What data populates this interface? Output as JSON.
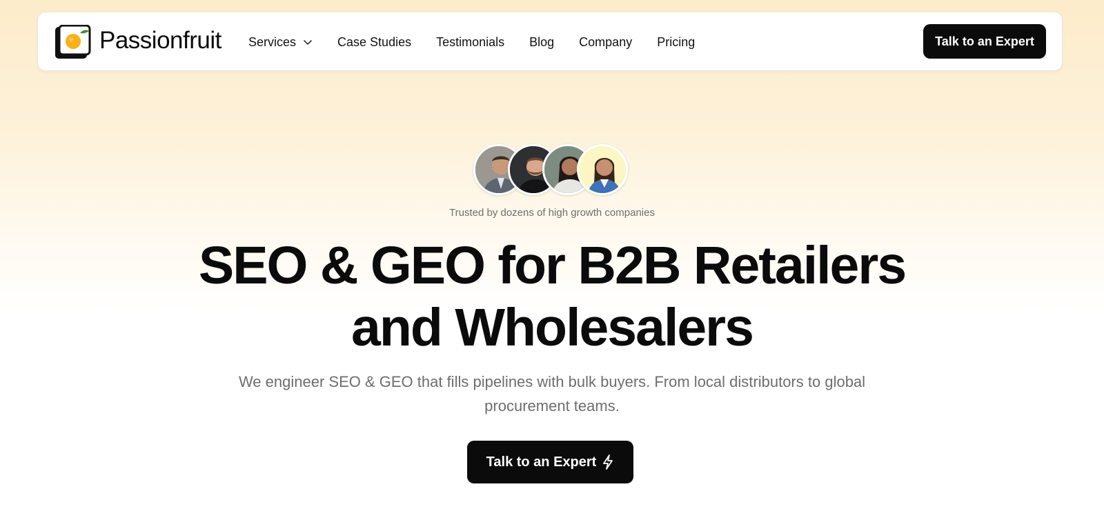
{
  "nav": {
    "brand": "Passionfruit",
    "items": [
      {
        "label": "Services",
        "has_dropdown": true
      },
      {
        "label": "Case Studies"
      },
      {
        "label": "Testimonials"
      },
      {
        "label": "Blog"
      },
      {
        "label": "Company"
      },
      {
        "label": "Pricing"
      }
    ],
    "cta_label": "Talk to an Expert"
  },
  "hero": {
    "avatars": [
      "avatar-man-suit-icon",
      "avatar-man-beard-icon",
      "avatar-woman-icon",
      "avatar-woman-smiling-icon"
    ],
    "trusted_text": "Trusted by dozens of high growth companies",
    "headline_line1": "SEO & GEO for B2B Retailers",
    "headline_line2": "and Wholesalers",
    "subtitle": "We engineer SEO & GEO that fills pipelines with bulk buyers. From local distributors to global procurement teams.",
    "cta_label": "Talk to an Expert",
    "cta_icon": "lightning-bolt-icon"
  },
  "colors": {
    "accent": "#0b0b0b",
    "background_top": "#fdeccb",
    "text_muted": "#6d6d6d"
  }
}
